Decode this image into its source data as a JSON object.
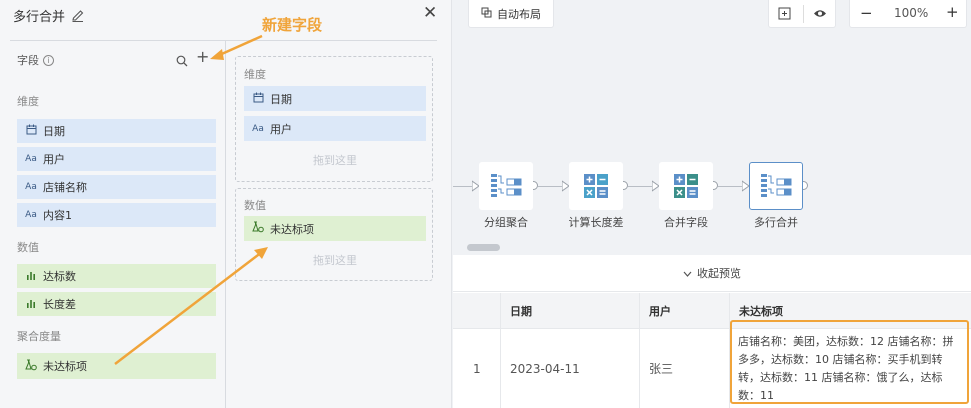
{
  "panel": {
    "title": "多行合并"
  },
  "fields": {
    "title": "字段",
    "dimension_label": "维度",
    "dimensions": [
      {
        "icon": "calendar-icon",
        "label": "日期"
      },
      {
        "icon": "text-icon",
        "label": "用户"
      },
      {
        "icon": "text-icon",
        "label": "店铺名称"
      },
      {
        "icon": "text-icon",
        "label": "内容1"
      }
    ],
    "measure_label": "数值",
    "measures": [
      {
        "icon": "bar-chart-icon",
        "label": "达标数"
      },
      {
        "icon": "bar-chart-icon",
        "label": "长度差"
      }
    ],
    "aggregate_label": "聚合度量",
    "aggregates": [
      {
        "icon": "aggregate-icon",
        "label": "未达标项"
      }
    ]
  },
  "config": {
    "dimension_box": {
      "title": "维度",
      "items": [
        "日期",
        "用户"
      ],
      "hint": "拖到这里"
    },
    "measure_box": {
      "title": "数值",
      "items": [
        "未达标项"
      ],
      "hint": "拖到这里"
    }
  },
  "annotation": {
    "label": "新建字段",
    "color": "#f0a43a"
  },
  "toolbar": {
    "auto_layout": "自动布局",
    "zoom": "100%",
    "zoom_out": "−",
    "zoom_in": "+"
  },
  "flow": {
    "nodes": [
      {
        "label": "分组聚合"
      },
      {
        "label": "计算长度差"
      },
      {
        "label": "合并字段"
      },
      {
        "label": "多行合并"
      }
    ]
  },
  "preview": {
    "collapse_label": "收起预览",
    "columns": [
      "日期",
      "用户",
      "未达标项"
    ],
    "rows": [
      {
        "index": "1",
        "date": "2023-04-11",
        "user": "张三",
        "unmet": "店铺名称：美团，达标数：12 店铺名称：拼多多，达标数：10 店铺名称：买手机到转转，达标数：11 店铺名称：饿了么，达标数：11"
      }
    ]
  },
  "colors": {
    "dimension_bg": "#dce8f8",
    "measure_bg": "#dff0d2",
    "accent": "#f0a43a",
    "node_blue": "#5b8fc8"
  }
}
